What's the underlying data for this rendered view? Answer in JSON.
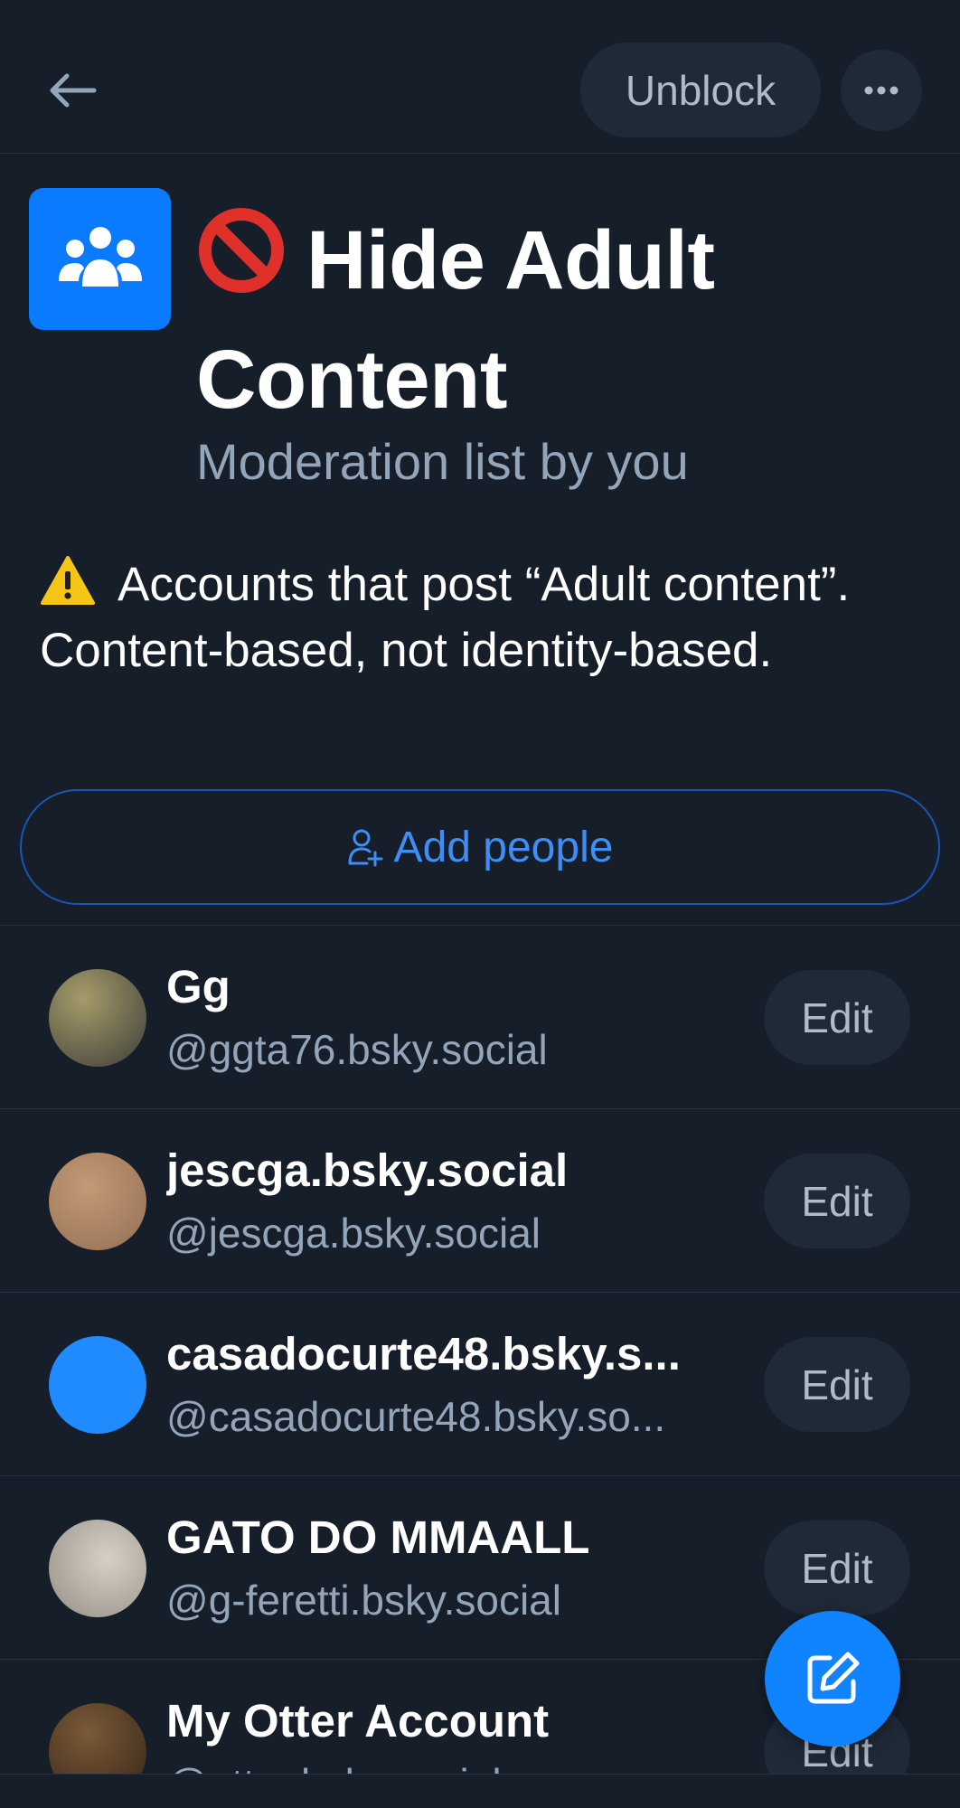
{
  "header": {
    "back_icon": "arrow-left-icon",
    "unblock_label": "Unblock",
    "more_icon": "ellipsis-icon"
  },
  "list": {
    "avatar_icon": "group-icon",
    "title_emoji": "prohibited-icon",
    "title": "Hide Adult Content",
    "subtitle": "Moderation list by you",
    "description_icon": "warning-icon",
    "description_line1": "Accounts that post “Adult content”.",
    "description_line2": "Content-based, not identity-based."
  },
  "add_people": {
    "icon": "person-add-icon",
    "label": "Add people"
  },
  "members": [
    {
      "name": "Gg",
      "handle": "@ggta76.bsky.social",
      "edit_label": "Edit",
      "avatar_color": "#7a6f4a"
    },
    {
      "name": "jescga.bsky.social",
      "handle": "@jescga.bsky.social",
      "edit_label": "Edit",
      "avatar_color": "#b08a6a"
    },
    {
      "name": "casadocurte48.bsky.s...",
      "handle": "@casadocurte48.bsky.so...",
      "edit_label": "Edit",
      "avatar_color": "#208bfe"
    },
    {
      "name": "GATO DO MMAALL",
      "handle": "@g-feretti.bsky.social",
      "edit_label": "Edit",
      "avatar_color": "#b8b2a8"
    },
    {
      "name": "My Otter Account",
      "handle": "@otter.bsky.social",
      "edit_label": "Edit",
      "avatar_color": "#5a3e26"
    }
  ],
  "fab": {
    "icon": "compose-icon"
  },
  "colors": {
    "background": "#161e2a",
    "accent": "#1083fe",
    "muted_text": "#93a5b8",
    "button_bg": "#1f2937"
  }
}
